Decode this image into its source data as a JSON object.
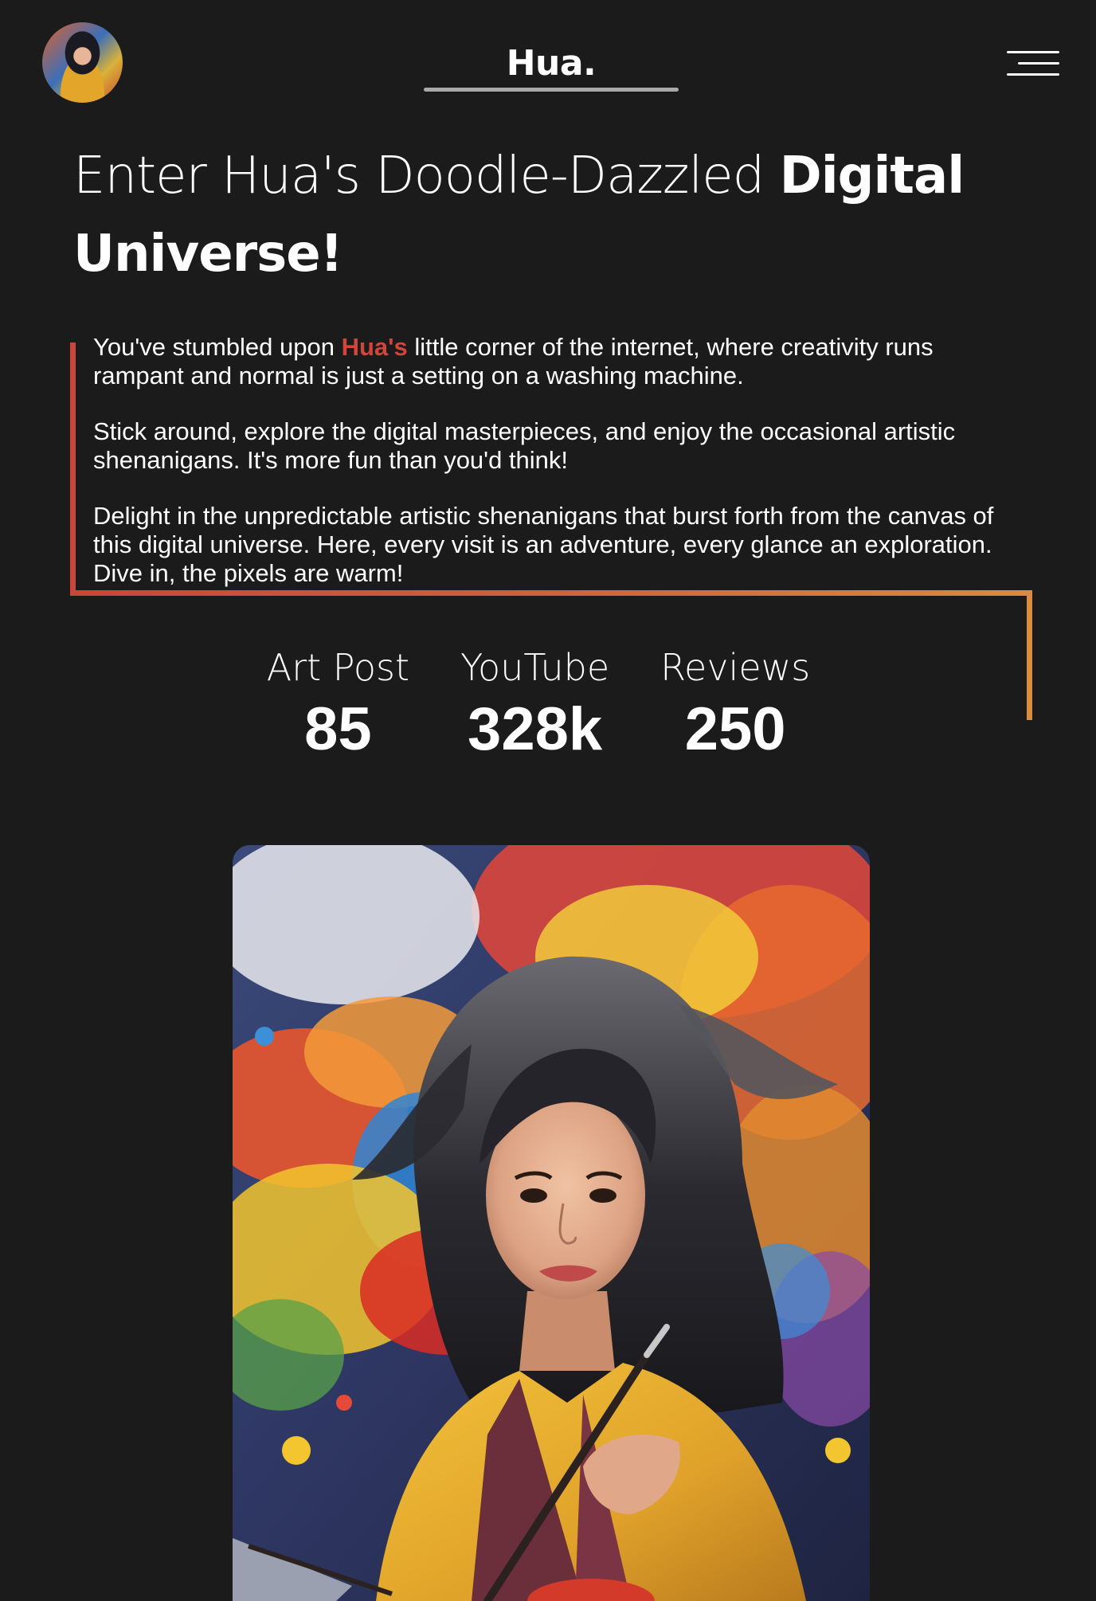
{
  "header": {
    "brand": "Hua.",
    "avatar_alt": "Hua avatar",
    "menu_icon": "hamburger-menu-icon"
  },
  "hero": {
    "title_light": "Enter Hua's Doodle-Dazzled ",
    "title_bold_1": "Digital",
    "title_bold_2": "Universe!"
  },
  "intro": {
    "p1_before": "You've stumbled upon ",
    "p1_name": "Hua's",
    "p1_after": " little corner of the internet, where creativity runs rampant and normal is just a setting on a washing machine.",
    "p2": "Stick around, explore the digital masterpieces, and enjoy the occasional artistic shenanigans. It's more fun than you'd think!",
    "p3": "Delight in the unpredictable artistic shenanigans that burst forth from the canvas of this digital universe. Here, every visit is an adventure, every glance an exploration. Dive in, the pixels are warm!"
  },
  "stats": [
    {
      "label": "Art Post",
      "value": "85"
    },
    {
      "label": "YouTube",
      "value": "328k"
    },
    {
      "label": "Reviews",
      "value": "250"
    }
  ],
  "colors": {
    "background": "#1b1b1c",
    "accent_red": "#d2453a",
    "accent_orange": "#dc8a3c",
    "text": "#ffffff"
  },
  "portrait": {
    "alt": "Painted portrait of Hua with colorful paint splashes, holding a brush"
  }
}
